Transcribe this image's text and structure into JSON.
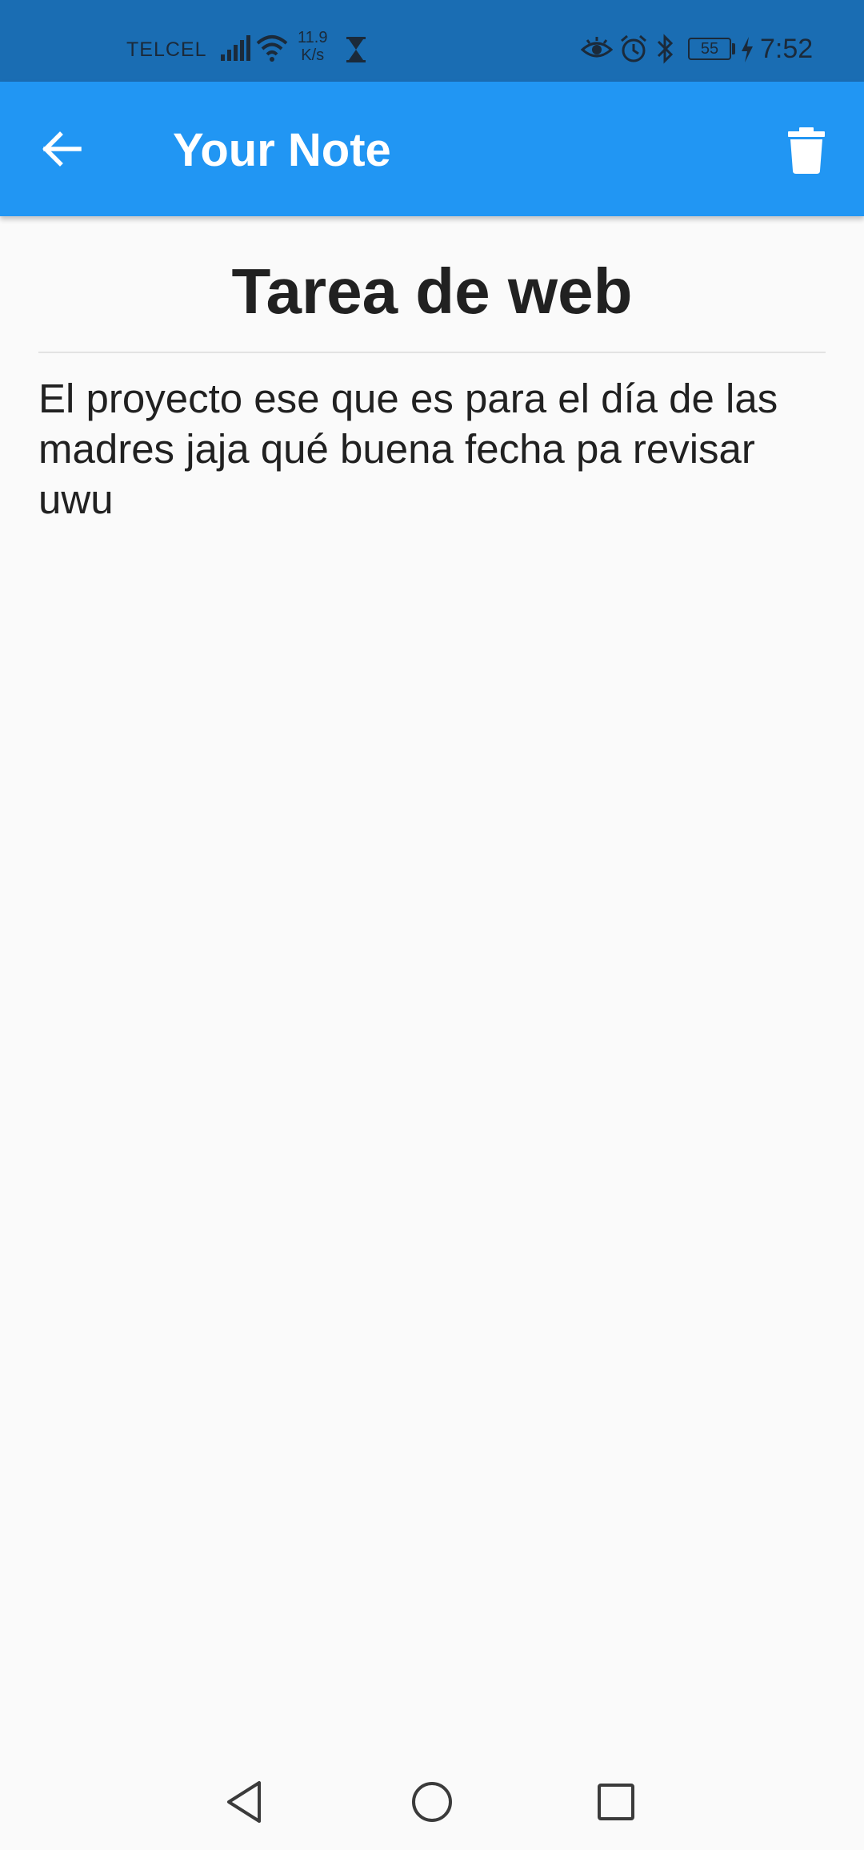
{
  "status_bar": {
    "carrier": "TELCEL",
    "speed_value": "11.9",
    "speed_unit": "K/s",
    "battery_level": "55",
    "time": "7:52"
  },
  "app_bar": {
    "title": "Your Note",
    "background_color": "#2196f3"
  },
  "note": {
    "title": "Tarea de web",
    "body": "El proyecto ese que es para el día de las madres jaja qué buena fecha pa revisar uwu"
  },
  "icons": {
    "back": "arrow-back-icon",
    "delete": "trash-icon",
    "nav_back": "triangle-back-icon",
    "nav_home": "circle-home-icon",
    "nav_recents": "square-recents-icon"
  }
}
